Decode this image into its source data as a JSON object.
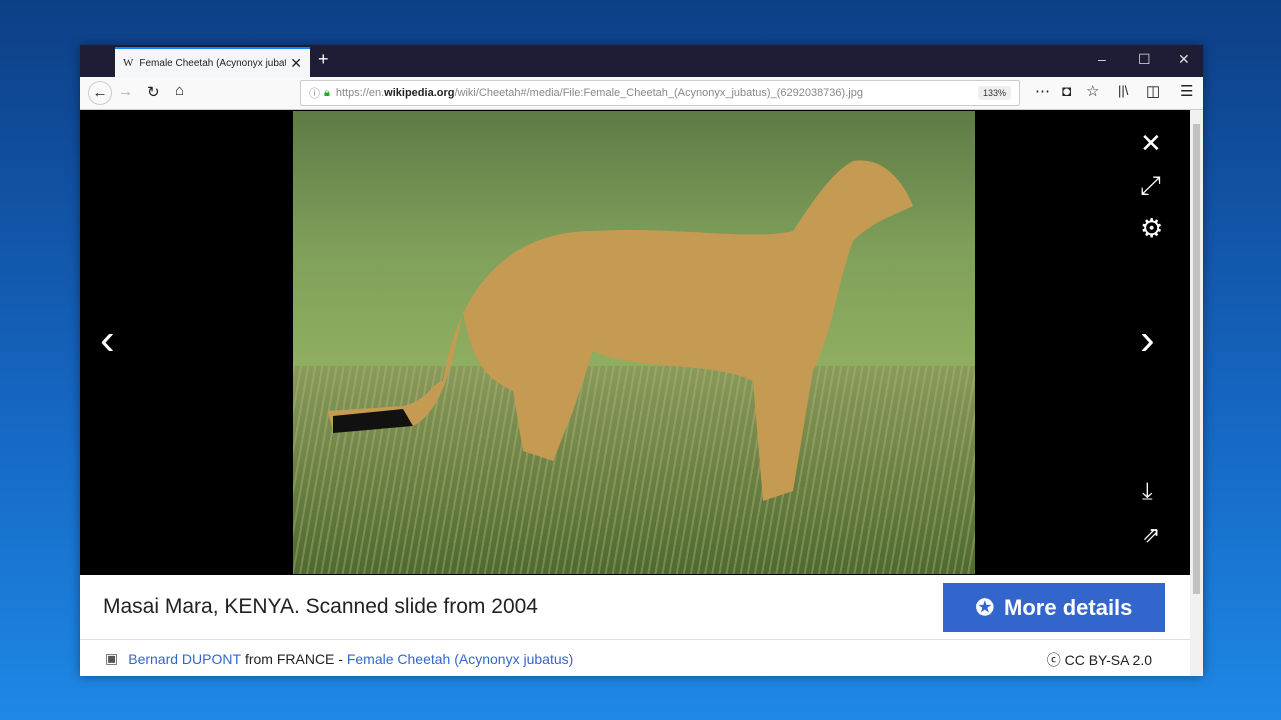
{
  "browser": {
    "tab_title": "Female Cheetah (Acynonyx jubatus)",
    "tab_favicon": "W",
    "url_prefix": "https://en.",
    "url_domain": "wikipedia.org",
    "url_path": "/wiki/Cheetah#/media/File:Female_Cheetah_(Acynonyx_jubatus)_(6292038736).jpg",
    "zoom": "133%"
  },
  "viewer": {
    "caption": "Masai Mara, KENYA. Scanned slide from 2004",
    "more_details": "More details",
    "author": "Bernard DUPONT",
    "from": "from FRANCE - ",
    "title_link": "Female Cheetah (Acynonyx jubatus)",
    "license": "CC BY-SA 2.0"
  }
}
